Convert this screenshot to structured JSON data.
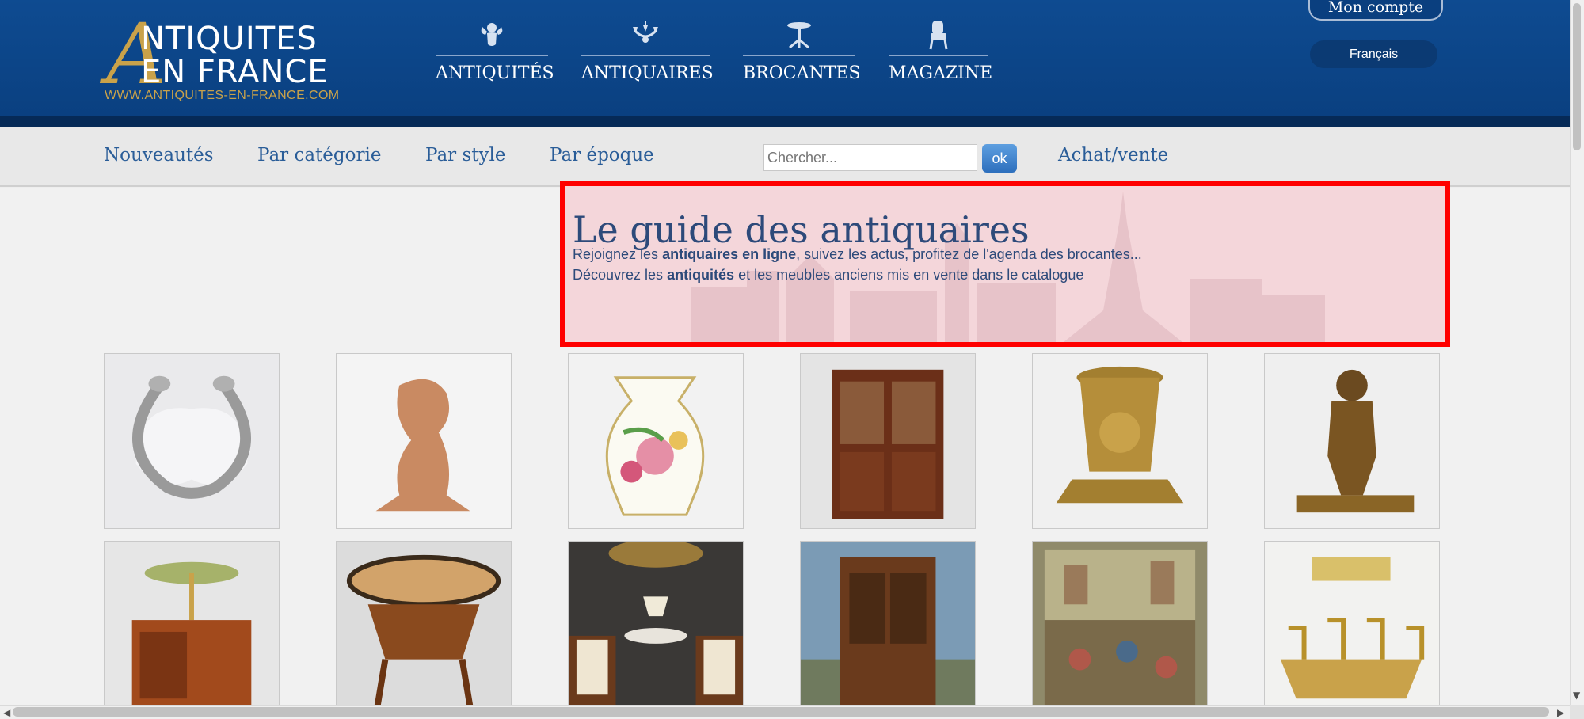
{
  "header": {
    "logo": {
      "line1": "NTIQUITES",
      "line2": "EN FRANCE",
      "big_letter": "A",
      "url": "WWW.ANTIQUITES-EN-FRANCE.COM"
    },
    "nav": [
      {
        "label": "ANTIQUITÉS",
        "icon": "cherub-icon"
      },
      {
        "label": "ANTIQUAIRES",
        "icon": "chandelier-icon"
      },
      {
        "label": "BROCANTES",
        "icon": "side-table-icon"
      },
      {
        "label": "MAGAZINE",
        "icon": "armchair-icon"
      }
    ],
    "account_label": "Mon compte",
    "language_label": "Français"
  },
  "subnav": {
    "items": [
      "Nouveautés",
      "Par catégorie",
      "Par style",
      "Par époque"
    ],
    "search_placeholder": "Chercher...",
    "ok_label": "ok",
    "buy_sell": "Achat/vente"
  },
  "guide": {
    "title": "Le guide des antiquaires",
    "line1_pre": "Rejoignez les ",
    "line1_bold": "antiquaires en ligne",
    "line1_post": ", suivez les actus, profitez de l'agenda des brocantes...",
    "line2_pre": "Découvrez les ",
    "line2_bold": "antiquités",
    "line2_post": " et les meubles anciens mis en vente dans le catalogue"
  },
  "products": [
    "silver-bracelet-image",
    "terracotta-figure-image",
    "floral-vase-image",
    "bookcase-cabinet-image",
    "gilt-figure-vase-image",
    "bronze-boy-statue-image",
    "bouillotte-lamp-table-image",
    "marquetry-gueridon-image",
    "interior-armchairs-image",
    "walnut-cabinet-image",
    "tapestry-image",
    "dining-table-chairs-image"
  ],
  "colors": {
    "header": "#0e4b91",
    "accent_gold": "#c9a24a",
    "link_blue": "#2a5d98",
    "highlight_red": "#ff0000"
  }
}
